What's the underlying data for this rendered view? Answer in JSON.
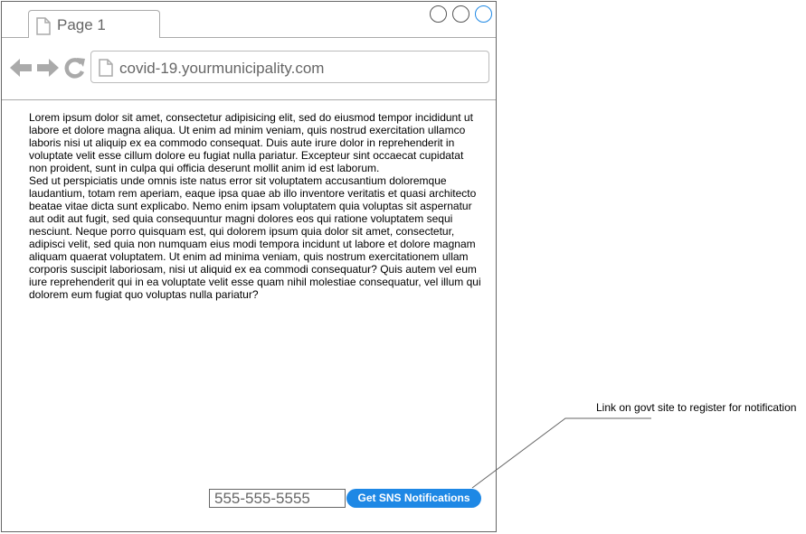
{
  "browser": {
    "tab_title": "Page 1",
    "url": "covid-19.yourmunicipality.com",
    "icons": {
      "tab": "document-icon",
      "back": "back-arrow-icon",
      "forward": "forward-arrow-icon",
      "reload": "reload-icon",
      "address": "document-icon",
      "window_controls": [
        "window-control-icon",
        "window-control-icon",
        "window-control-icon"
      ]
    }
  },
  "content": {
    "paragraph_1": "Lorem ipsum dolor sit amet, consectetur adipisicing elit, sed do eiusmod tempor incididunt ut labore et dolore magna aliqua. Ut enim ad minim veniam, quis nostrud exercitation ullamco laboris nisi ut aliquip ex ea commodo consequat. Duis aute irure dolor in reprehenderit in voluptate velit esse cillum dolore eu fugiat nulla pariatur. Excepteur sint occaecat cupidatat non proident, sunt in culpa qui officia deserunt mollit anim id est laborum.",
    "paragraph_2": "Sed ut perspiciatis unde omnis iste natus error sit voluptatem accusantium doloremque laudantium, totam rem aperiam, eaque ipsa quae ab illo inventore veritatis et quasi architecto beatae vitae dicta sunt explicabo. Nemo enim ipsam voluptatem quia voluptas sit aspernatur aut odit aut fugit, sed quia consequuntur magni dolores eos qui ratione voluptatem sequi nesciunt. Neque porro quisquam est, qui dolorem ipsum quia dolor sit amet, consectetur, adipisci velit, sed quia non numquam eius modi tempora incidunt ut labore et dolore magnam aliquam quaerat voluptatem. Ut enim ad minima veniam, quis nostrum exercitationem ullam corporis suscipit laboriosam, nisi ut aliquid ex ea commodi consequatur? Quis autem vel eum iure reprehenderit qui in ea voluptate velit esse quam nihil molestiae consequatur, vel illum qui dolorem eum fugiat quo voluptas nulla pariatur?"
  },
  "signup": {
    "phone_value": "555-555-5555",
    "button_label": "Get SNS Notifications"
  },
  "annotation": {
    "text": "Link on govt site to register for notification"
  },
  "colors": {
    "accent": "#1e88e5",
    "border": "#666666",
    "icon_gray": "#aaaaaa"
  }
}
